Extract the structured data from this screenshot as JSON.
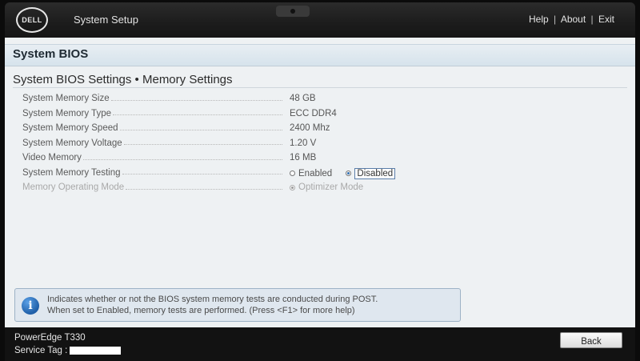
{
  "topbar": {
    "logo_text": "DELL",
    "app_title": "System Setup",
    "links": [
      "Help",
      "About",
      "Exit"
    ]
  },
  "header": {
    "title": "System BIOS"
  },
  "section": {
    "title": "System BIOS Settings • Memory Settings"
  },
  "settings": [
    {
      "label": "System Memory Size",
      "value": "48 GB"
    },
    {
      "label": "System Memory Type",
      "value": "ECC DDR4"
    },
    {
      "label": "System Memory Speed",
      "value": "2400 Mhz"
    },
    {
      "label": "System Memory Voltage",
      "value": "1.20 V"
    },
    {
      "label": "Video Memory",
      "value": "16 MB"
    },
    {
      "label": "System Memory Testing",
      "options": [
        "Enabled",
        "Disabled"
      ],
      "selected": "Disabled"
    },
    {
      "label": "Memory Operating Mode",
      "options": [
        "Optimizer Mode"
      ],
      "selected": "Optimizer Mode",
      "disabled": true
    }
  ],
  "help": {
    "line1": "Indicates whether or not the BIOS system memory tests are conducted during POST.",
    "line2": "When set to Enabled, memory tests are performed. (Press <F1> for more help)"
  },
  "footer": {
    "model": "PowerEdge T330",
    "service_tag_label": "Service Tag :",
    "back_label": "Back"
  },
  "colors": {
    "accent": "#2f6db0",
    "header_bg": "#d6e3ec",
    "panel_bg": "#eef1f3"
  }
}
